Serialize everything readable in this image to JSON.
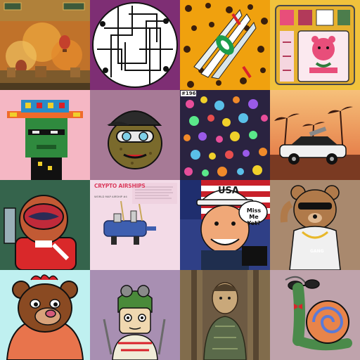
{
  "gallery": {
    "tiles": [
      {
        "id": "balloons-village",
        "bg": "#c0722a"
      },
      {
        "id": "circle-lines",
        "bg": "#7e2e74"
      },
      {
        "id": "leopard-claw",
        "bg": "#f0a10e"
      },
      {
        "id": "strawberry-bear-card",
        "bg": "#f1c23c"
      },
      {
        "id": "pixel-sombrero-alien",
        "bg": "#f5b7c4"
      },
      {
        "id": "potato-cap-goggles",
        "bg": "#a77a96"
      },
      {
        "id": "confetti-dots",
        "bg": "#2a2340",
        "number_label": "#196"
      },
      {
        "id": "palm-sunset-car",
        "bg": "#e89a52"
      },
      {
        "id": "space-helmet-character",
        "bg": "#3c6e55"
      },
      {
        "id": "crypto-airships",
        "bg": "#f3dbe7",
        "title": "CRYPTO AIRSHIPS",
        "subtitle": "WORLD MAP AIRSHIP #4"
      },
      {
        "id": "usa-cap-cartoon",
        "bg": "#2f3f86",
        "cap_text": "USA",
        "bubble_text": "Miss Me Yet?"
      },
      {
        "id": "gangster-bear",
        "bg": "#a9896e",
        "shirt_text": "GANG"
      },
      {
        "id": "hoodie-bear",
        "bg": "#bff0f0"
      },
      {
        "id": "frog-kid",
        "bg": "#a88fb2"
      },
      {
        "id": "mosaic-soldier",
        "bg": "#6d5a43"
      },
      {
        "id": "sunglasses-snail",
        "bg": "#bfa3ac"
      }
    ]
  }
}
